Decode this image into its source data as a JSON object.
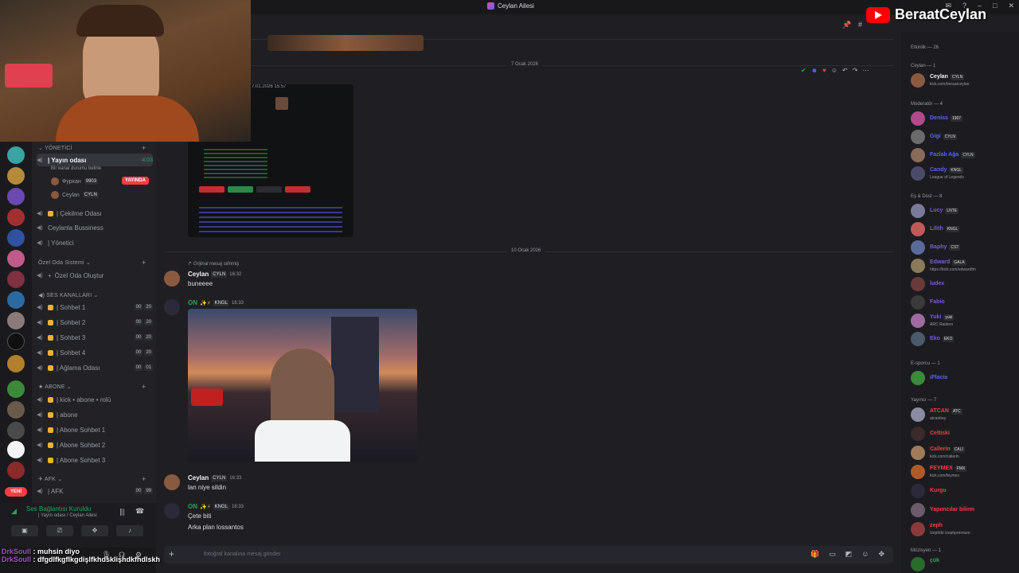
{
  "window": {
    "title": "Ceylan Ailesi"
  },
  "overlay": {
    "channel_name": "BeraatCeylan",
    "stream_chat": [
      {
        "user": "DrkSoull",
        "text": "muhsin diyo"
      },
      {
        "user": "DrkSoull",
        "text": "dfgdlfkgflkgdişlfkhdsklişhdkfhdlskh"
      }
    ]
  },
  "servers": {
    "new_label": "YENİ"
  },
  "channels": {
    "cat_admin": "YÖNETİCİ",
    "stream_room": "| Yayın odası",
    "stream_room_time": "4:03",
    "stream_room_desc": "Bir kanal durumu belirle",
    "user1": "Фурхан",
    "user1_tag": "9903",
    "user2": "Ceylan",
    "user2_tag": "CYLN",
    "live_label": "YAYINDA",
    "ch_cekilme": "| Çekilme Odası",
    "ch_business": "Ceylanla Bussiness",
    "ch_yonetici": "| Yönetici",
    "cat_private": "Özel Oda Sistemi",
    "ch_create": "Özel Oda Oluştur",
    "cat_voice": "SES KANALLARI",
    "voice_rooms": [
      {
        "name": "| Sohbet 1",
        "a": "00",
        "b": "20"
      },
      {
        "name": "| Sohbet 2",
        "a": "00",
        "b": "20"
      },
      {
        "name": "| Sohbet 3",
        "a": "00",
        "b": "20"
      },
      {
        "name": "| Sohbet 4",
        "a": "00",
        "b": "20"
      },
      {
        "name": "| Ağlama Odası",
        "a": "00",
        "b": "01"
      }
    ],
    "cat_sub": "ABONE",
    "sub_rooms": [
      "| kick • abone • rolü",
      "| abone",
      "| Abone Sohbet 1",
      "| Abone Sohbet 2",
      "| Abone Sohbet 3"
    ],
    "cat_afk": "AFK",
    "ch_afk": "| AFK",
    "afk_a": "00",
    "afk_b": "99"
  },
  "voice_panel": {
    "status": "Ses Bağlantısı Kuruldu",
    "location": "| Yayın odası / Ceylan Ailesi"
  },
  "chat": {
    "date1": "7 Ocak 2026",
    "embed_time": "7.01.2026 15:57",
    "date2": "10 Ocak 2026",
    "reply_note": "Orijinal mesaj silinmiş",
    "messages": [
      {
        "user": "Ceylan",
        "tag": "CYLN",
        "time": "16:32",
        "lines": [
          "buneeee"
        ],
        "color": "#f2f3f5"
      },
      {
        "user": "ON",
        "tag": "KNGL",
        "time": "16:33",
        "lines": [],
        "color": "#23a55a"
      },
      {
        "user": "Ceylan",
        "tag": "CYLN",
        "time": "16:33",
        "lines": [
          "lan niye sildin"
        ],
        "color": "#f2f3f5"
      },
      {
        "user": "ON",
        "tag": "KNGL",
        "time": "16:33",
        "lines": [
          "Çete biti",
          "Arka plan lossantos"
        ],
        "color": "#23a55a"
      }
    ],
    "composer_placeholder": "fotoğraf kanalına mesaj gönder"
  },
  "members": {
    "header": "Etkinlik — 26",
    "cat_owner": "Ceylan — 1",
    "owner": {
      "name": "Ceylan",
      "tag": "CYLN",
      "status": "kick.com/beraatceylan"
    },
    "cat_mod": "Moderatör — 4",
    "mods": [
      {
        "name": "Deniss",
        "tag": "1907",
        "color": "#5865f2",
        "status": ""
      },
      {
        "name": "Gigi",
        "tag": "CYLN",
        "color": "#5865f2",
        "status": ""
      },
      {
        "name": "Fazlalı Ağa",
        "tag": "CYLN",
        "color": "#5865f2",
        "status": ""
      },
      {
        "name": "Candy",
        "tag": "KNGL",
        "color": "#5865f2",
        "status": "League of Legends"
      }
    ],
    "cat_friends": "Eş & Dost — 8",
    "friends": [
      {
        "name": "Lucy",
        "tag": "LNTE",
        "color": "#7b5cd6",
        "status": ""
      },
      {
        "name": "Lilith",
        "tag": "KNGL",
        "color": "#7b5cd6",
        "status": ""
      },
      {
        "name": "Baphy",
        "tag": "CST",
        "color": "#7b5cd6",
        "status": ""
      },
      {
        "name": "Edward",
        "tag": "GALA",
        "color": "#7b5cd6",
        "status": "https://kick.com/edwardfm"
      },
      {
        "name": "ludex",
        "tag": "",
        "color": "#7b5cd6",
        "status": ""
      },
      {
        "name": "Fabio",
        "tag": "",
        "color": "#7b5cd6",
        "status": ""
      },
      {
        "name": "Yuki",
        "tag": "yuki",
        "color": "#7b5cd6",
        "status": "ARC Raiders"
      },
      {
        "name": "Eko",
        "tag": "EKO",
        "color": "#7b5cd6",
        "status": ""
      }
    ],
    "cat_esport": "E-sporcu — 1",
    "esport": {
      "name": "iPlacia",
      "status": ""
    },
    "cat_streamer": "Yayıncı — 7",
    "streamers": [
      {
        "name": "ATCAN",
        "tag": "ATC",
        "color": "#f23f43",
        "status": "atcanbey"
      },
      {
        "name": "Celtiski",
        "tag": "",
        "color": "#f23f43",
        "status": ""
      },
      {
        "name": "Callerin",
        "tag": "CALİ",
        "color": "#f23f43",
        "status": "kick.com/callerin"
      },
      {
        "name": "FEYMEX",
        "tag": "FMX",
        "color": "#f23f43",
        "status": "kick.com/feymex"
      },
      {
        "name": "Kurgu",
        "tag": "",
        "color": "#f23f43",
        "status": ""
      },
      {
        "name": "Yapımcılar bilirm",
        "tag": "",
        "color": "#f23f43",
        "status": ""
      },
      {
        "name": "zeph",
        "tag": "",
        "color": "#f23f43",
        "status": "/zephtbl /zephpremium"
      }
    ],
    "cat_music": "Müzisyen — 1",
    "musician": {
      "name": "çük",
      "status": ""
    }
  }
}
